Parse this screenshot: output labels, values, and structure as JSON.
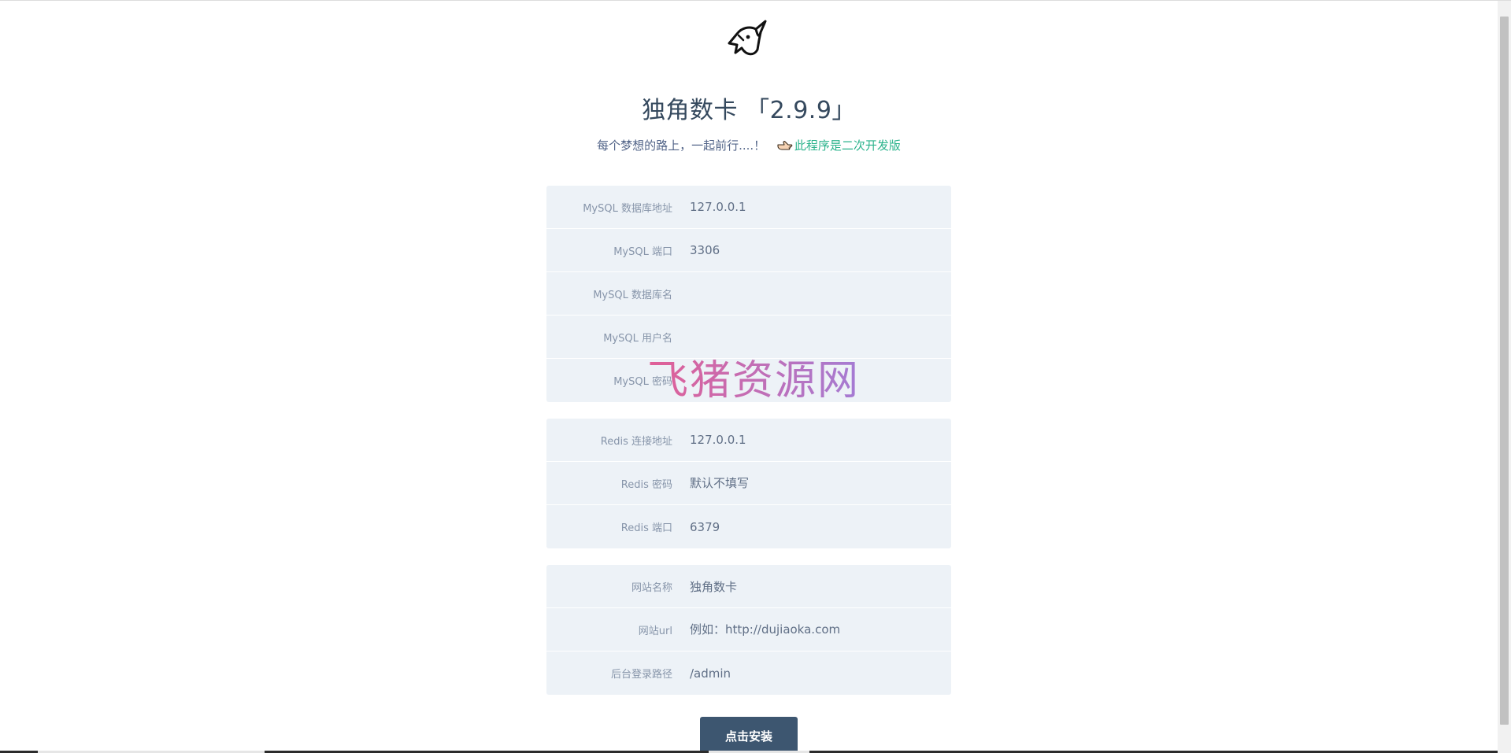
{
  "logo": {
    "icon": "unicorn-logo-icon"
  },
  "header": {
    "title": "独角数卡 「2.9.9」",
    "subtitle_text": "每个梦想的路上，一起前行....！",
    "link_icon": "pointing-hand-icon",
    "link_text": "此程序是二次开发版"
  },
  "mysql": [
    {
      "label": "MySQL 数据库地址",
      "value": "127.0.0.1",
      "placeholder": ""
    },
    {
      "label": "MySQL 端口",
      "value": "3306",
      "placeholder": ""
    },
    {
      "label": "MySQL 数据库名",
      "value": "",
      "placeholder": ""
    },
    {
      "label": "MySQL 用户名",
      "value": "",
      "placeholder": ""
    },
    {
      "label": "MySQL 密码",
      "value": "",
      "placeholder": ""
    }
  ],
  "redis": [
    {
      "label": "Redis 连接地址",
      "value": "127.0.0.1",
      "placeholder": ""
    },
    {
      "label": "Redis 密码",
      "value": "",
      "placeholder": "默认不填写"
    },
    {
      "label": "Redis 端口",
      "value": "6379",
      "placeholder": ""
    }
  ],
  "site": [
    {
      "label": "网站名称",
      "value": "独角数卡",
      "placeholder": ""
    },
    {
      "label": "网站url",
      "value": "",
      "placeholder": "例如：http://dujiaoka.com"
    },
    {
      "label": "后台登录路径",
      "value": "/admin",
      "placeholder": ""
    }
  ],
  "install_button": "点击安装",
  "watermark": "飞猪资源网",
  "colors": {
    "accent_link": "#2bb38c",
    "button_bg": "#3d5670",
    "panel_bg": "#edf2f7",
    "title": "#35495e"
  }
}
